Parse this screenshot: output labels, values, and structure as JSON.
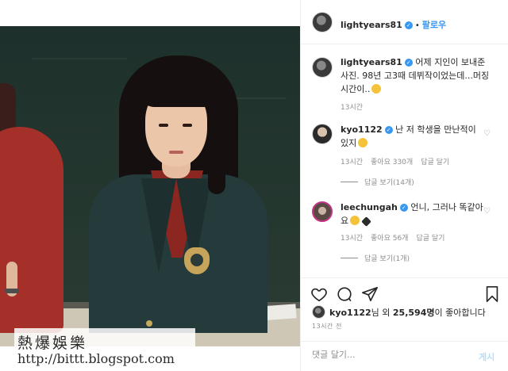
{
  "watermark": {
    "line1": "熱爆娛樂",
    "line2": "http://bittt.blogspot.com"
  },
  "header": {
    "username": "lightyears81",
    "separator": "•",
    "follow_label": "팔로우"
  },
  "caption": {
    "username": "lightyears81",
    "text": "어제 지인이 보내준 사진. 98년 고3때 데뷔작이었는데...머징 시간이..",
    "time": "13시간"
  },
  "comments": [
    {
      "username": "kyo1122",
      "text": "난 저 학생을 만난적이 있지",
      "time": "13시간",
      "likes": "좋아요 330개",
      "reply_label": "답글 달기",
      "view_replies": "답글 보기(14개)"
    },
    {
      "username": "leechungah",
      "text": "언니, 그러나 똑같아요",
      "time": "13시간",
      "likes": "좋아요 56개",
      "reply_label": "답글 달기",
      "view_replies": "답글 보기(1개)"
    }
  ],
  "likes_line": {
    "username": "kyo1122",
    "middle": "님 외 ",
    "count": "25,594명",
    "suffix": "이 좋아합니다"
  },
  "post_time": "13시간 전",
  "add_comment": {
    "placeholder": "댓글 달기...",
    "post_label": "게시"
  },
  "icons": {
    "like": "heart-icon",
    "comment": "comment-bubble-icon",
    "share": "paper-plane-icon",
    "save": "bookmark-icon",
    "verified": "verified-badge-icon",
    "comment_like": "heart-outline-icon"
  },
  "colors": {
    "link_blue": "#3897f0",
    "muted_gray": "#8e8e8e",
    "text": "#262626",
    "post_disabled": "#b2dffc"
  }
}
